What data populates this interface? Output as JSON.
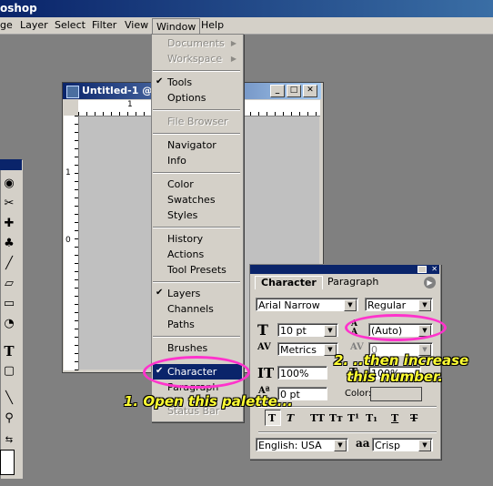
{
  "app": {
    "title_fragment": "oshop"
  },
  "menubar": {
    "items": [
      "ge",
      "Layer",
      "Select",
      "Filter",
      "View",
      "Window",
      "Help"
    ]
  },
  "window_menu": {
    "items": [
      {
        "label": "Documents",
        "disabled": true,
        "submenu": true
      },
      {
        "label": "Workspace",
        "disabled": true,
        "submenu": true
      },
      {
        "label": "Tools",
        "checked": true
      },
      {
        "label": "Options"
      },
      {
        "label": "File Browser",
        "disabled": true
      },
      {
        "label": "Navigator"
      },
      {
        "label": "Info"
      },
      {
        "label": "Color"
      },
      {
        "label": "Swatches"
      },
      {
        "label": "Styles"
      },
      {
        "label": "History"
      },
      {
        "label": "Actions"
      },
      {
        "label": "Tool Presets"
      },
      {
        "label": "Layers",
        "checked": true
      },
      {
        "label": "Channels"
      },
      {
        "label": "Paths"
      },
      {
        "label": "Brushes"
      },
      {
        "label": "Character",
        "checked": true,
        "highlighted": true
      },
      {
        "label": "Paragraph"
      },
      {
        "label": "Status Bar"
      }
    ]
  },
  "document": {
    "title": "Untitled-1 @",
    "ruler_top_label": "1",
    "ruler_left_labels": [
      "1",
      "0"
    ]
  },
  "character_palette": {
    "tabs": [
      "Character",
      "Paragraph"
    ],
    "font_family": "Arial Narrow",
    "font_style": "Regular",
    "font_size": "10 pt",
    "leading": "(Auto)",
    "kerning": "Metrics",
    "tracking": "0",
    "vertical_scale": "100%",
    "horizontal_scale": "100%",
    "baseline_shift": "0 pt",
    "color_label": "Color:",
    "language": "English: USA",
    "aa_icon_label": "aa",
    "antialias": "Crisp",
    "style_buttons": [
      "T",
      "T",
      "TT",
      "Tт",
      "T¹",
      "T₁",
      "T",
      "T"
    ]
  },
  "annotations": {
    "step1": "1. Open this palette...",
    "step2_line1": "2. ..then increase",
    "step2_line2": "this number.",
    "highlight_color": "#ff33cc",
    "text_color": "#ffff33"
  },
  "colors": {
    "titlebar": "#0a246a",
    "menu_bg": "#d4d0c8",
    "workspace": "#808080"
  }
}
